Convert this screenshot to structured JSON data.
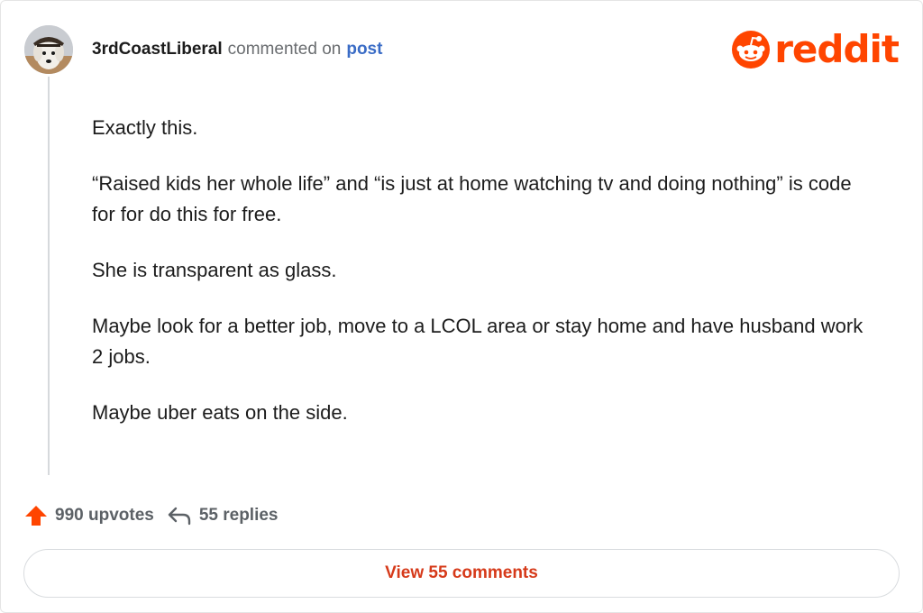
{
  "comment": {
    "username": "3rdCoastLiberal",
    "action_text": "commented on",
    "post_link": "post",
    "paragraphs": [
      "Exactly this.",
      "“Raised kids her whole life” and “is just at home watching tv and doing nothing” is code for for do this for free.",
      "She is transparent as glass.",
      "Maybe look for a better job, move to a LCOL area or stay home and have husband work 2 jobs.",
      "Maybe uber eats on the side."
    ]
  },
  "brand": {
    "name": "reddit",
    "color": "#ff4500"
  },
  "stats": {
    "upvotes": "990 upvotes",
    "replies": "55 replies"
  },
  "footer": {
    "view_comments": "View 55 comments"
  },
  "icons": {
    "avatar": "avatar",
    "upvote": "upvote-arrow-icon",
    "reply": "reply-arrow-icon",
    "logo": "reddit-snoo-icon"
  }
}
